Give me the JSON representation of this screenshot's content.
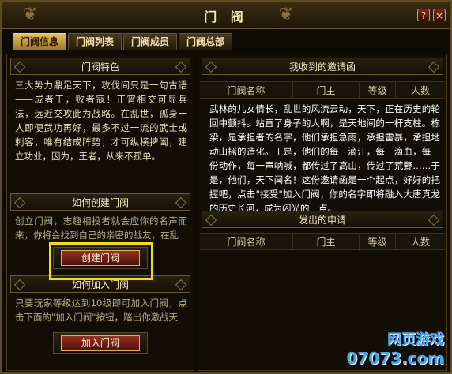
{
  "window": {
    "title": "门 阀"
  },
  "titlebar_buttons": {
    "help": "?",
    "close": "×"
  },
  "tabs": [
    {
      "label": "门阀信息",
      "active": true
    },
    {
      "label": "门阀列表",
      "active": false
    },
    {
      "label": "门阀成员",
      "active": false
    },
    {
      "label": "门阀总部",
      "active": false
    }
  ],
  "left": {
    "feature": {
      "heading": "门阀特色",
      "text": "三大势力鼎足天下，攻伐间只是一句古语——成者王，败者寇！正宵相交可显兵法，远近交攻此为战略。在乱世，孤身一人即便武功再好，最多不过一流的武士或刺客，唯有结成阵势，才可纵横捭阖，建立功业，因为，王者，从来不孤单。"
    },
    "create": {
      "heading": "如何创建门阀",
      "text": "创立门阀，志趣相投者就会应你的名声而来，你将会找到自己的亲密的战友，在乱",
      "button": "创建门阀"
    },
    "join": {
      "heading": "如何加入门阀",
      "text": "只要玩家等级达到10级即可加入门阀，点击下面的\"加入门阀\"按钮，踏出你激战天",
      "button": "加入门阀"
    }
  },
  "right": {
    "invites": {
      "heading": "我收到的邀请函",
      "columns": [
        "门阀名称",
        "门主",
        "等级",
        "人数"
      ],
      "letter": "武林的儿女情长，乱世的风流云动，天下，正在历史的轮回中颤抖。站直了身子的人啊，是天地间的一杆支柱。栋梁，是承担者的名字，他们承担急雨，承担雷暴，承担地动山摇的造化。于是，他们的每一滴汗，每一滴血，每一份动作，每一声呐喊，都传过了高山，传过了荒野……于是，他们，天下闻名！这份邀请函是一个起点，好好的把握吧，点击\"接受\"加入门阀，你的名字即将融入大唐真龙的历史长河，成为闪光的一点。"
    },
    "applications": {
      "heading": "发出的申请",
      "columns": [
        "门阀名称",
        "门主",
        "等级",
        "人数"
      ]
    }
  },
  "watermark": {
    "title": "网页游戏",
    "url": "07073.com"
  }
}
